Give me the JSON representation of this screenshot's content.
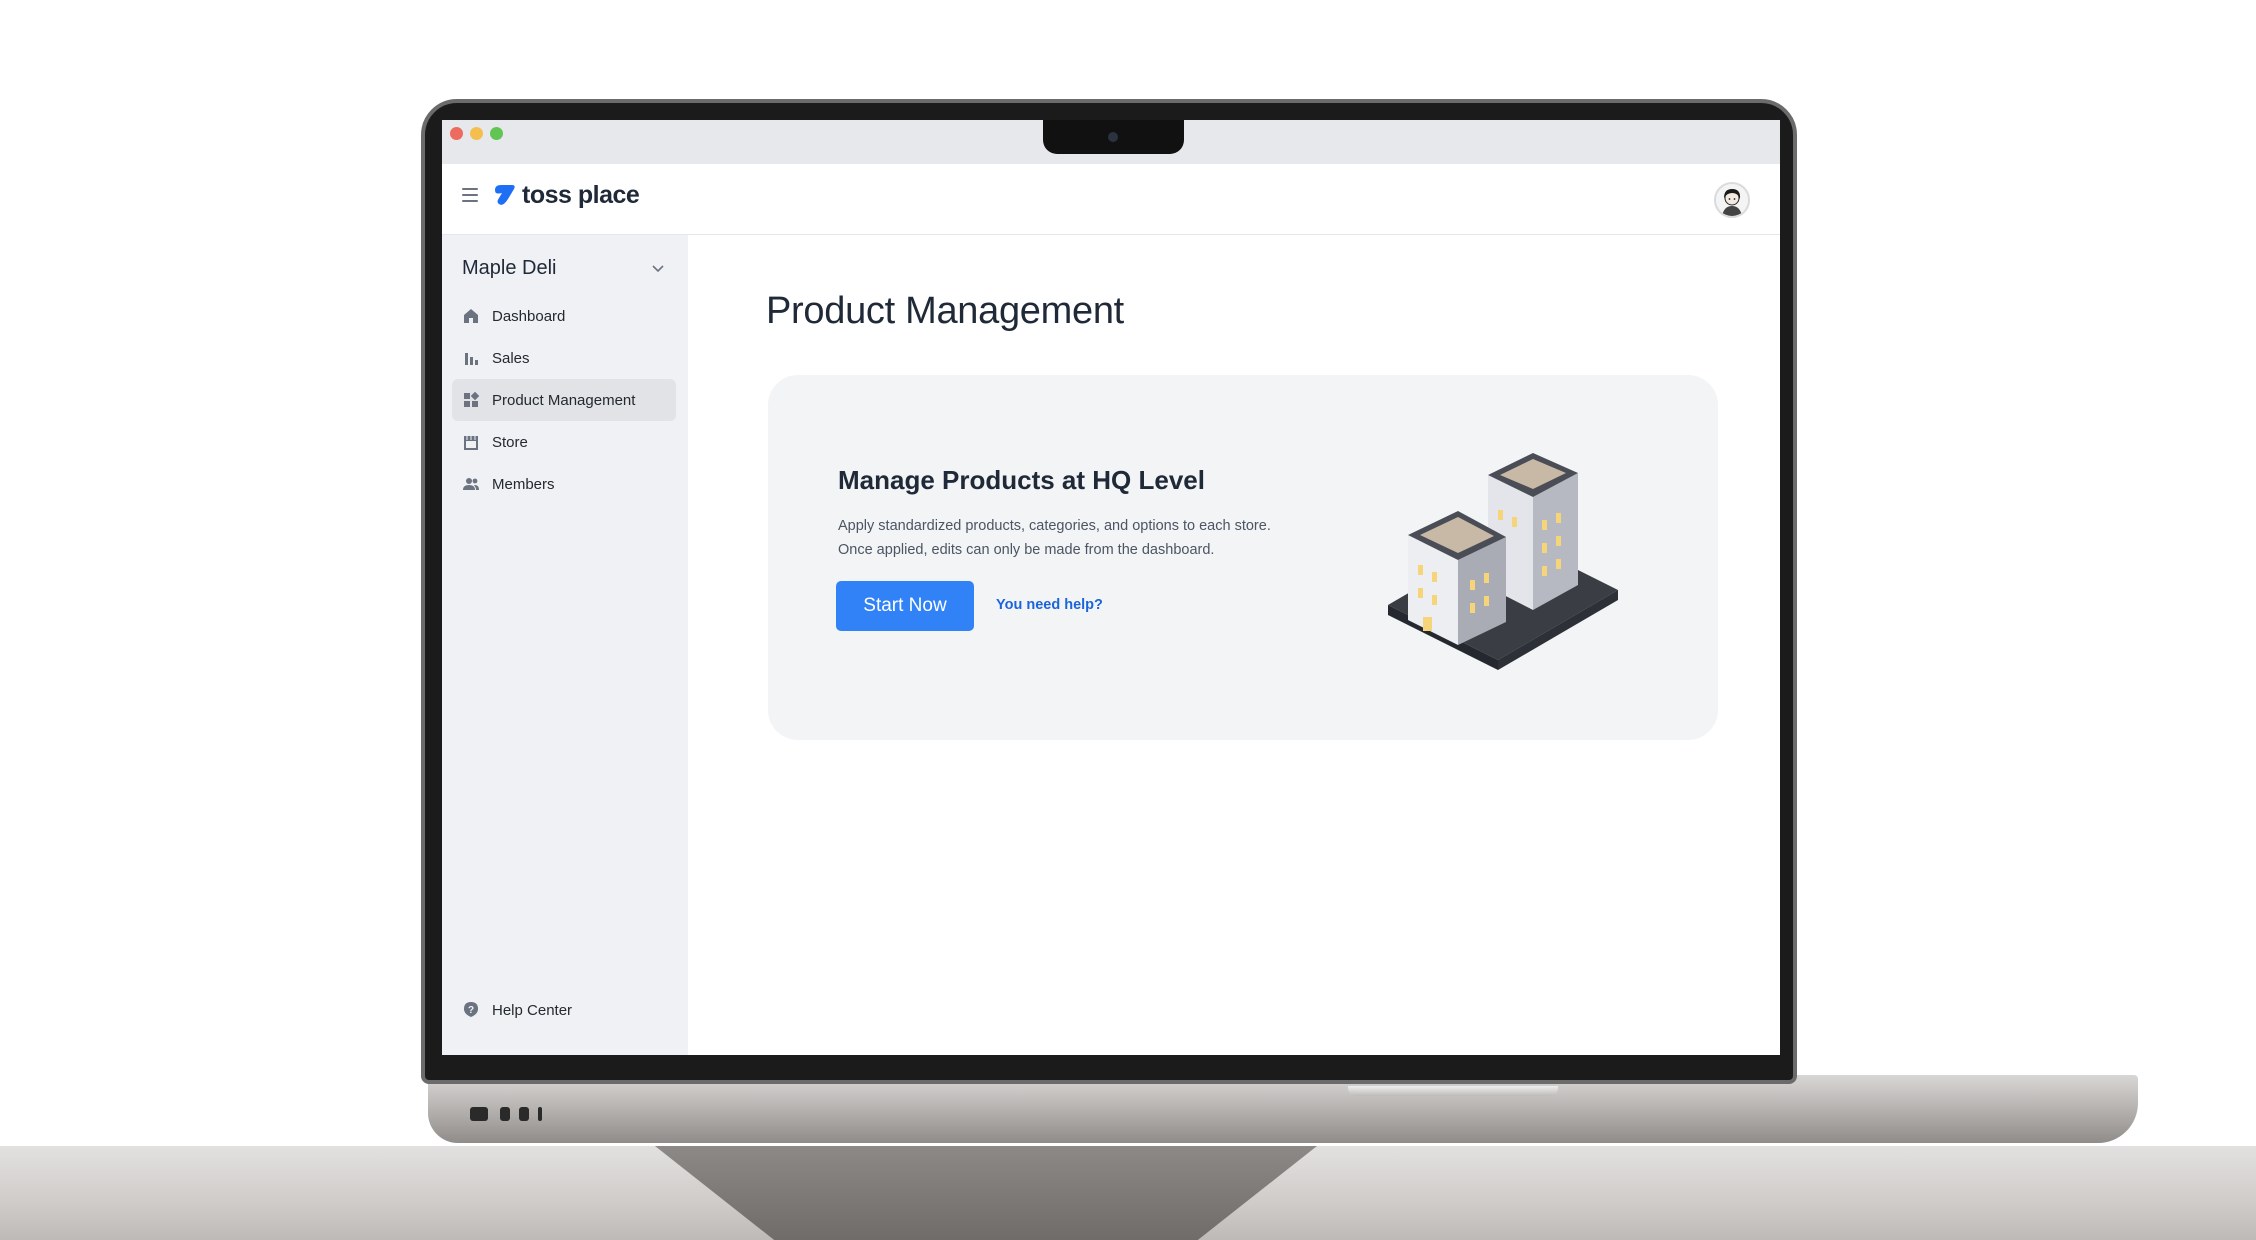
{
  "app": {
    "brand_name": "toss place",
    "window_controls": [
      "close",
      "minimize",
      "zoom"
    ],
    "colors": {
      "accent": "#3182f6",
      "link": "#1b64da",
      "sidebar_bg": "#f0f1f4",
      "card_bg": "#f3f4f6"
    }
  },
  "header": {
    "menu_icon": "hamburger-icon",
    "avatar_icon": "user-avatar"
  },
  "sidebar": {
    "store_name": "Maple Deli",
    "store_dropdown_icon": "chevron-down-icon",
    "items": [
      {
        "label": "Dashboard",
        "icon": "home-icon",
        "active": false
      },
      {
        "label": "Sales",
        "icon": "bar-chart-icon",
        "active": false
      },
      {
        "label": "Product Management",
        "icon": "grid-icon",
        "active": true
      },
      {
        "label": "Store",
        "icon": "storefront-icon",
        "active": false
      },
      {
        "label": "Members",
        "icon": "people-icon",
        "active": false
      }
    ],
    "help_center": {
      "label": "Help Center",
      "icon": "help-icon"
    }
  },
  "main": {
    "page_title": "Product Management",
    "card": {
      "title": "Manage Products at HQ Level",
      "description_lines": [
        "Apply standardized products, categories, and options to each store.",
        "Once applied, edits can only be made from the dashboard."
      ],
      "primary_button": "Start Now",
      "help_link": "You need help?",
      "illustration": "buildings-illustration"
    }
  }
}
